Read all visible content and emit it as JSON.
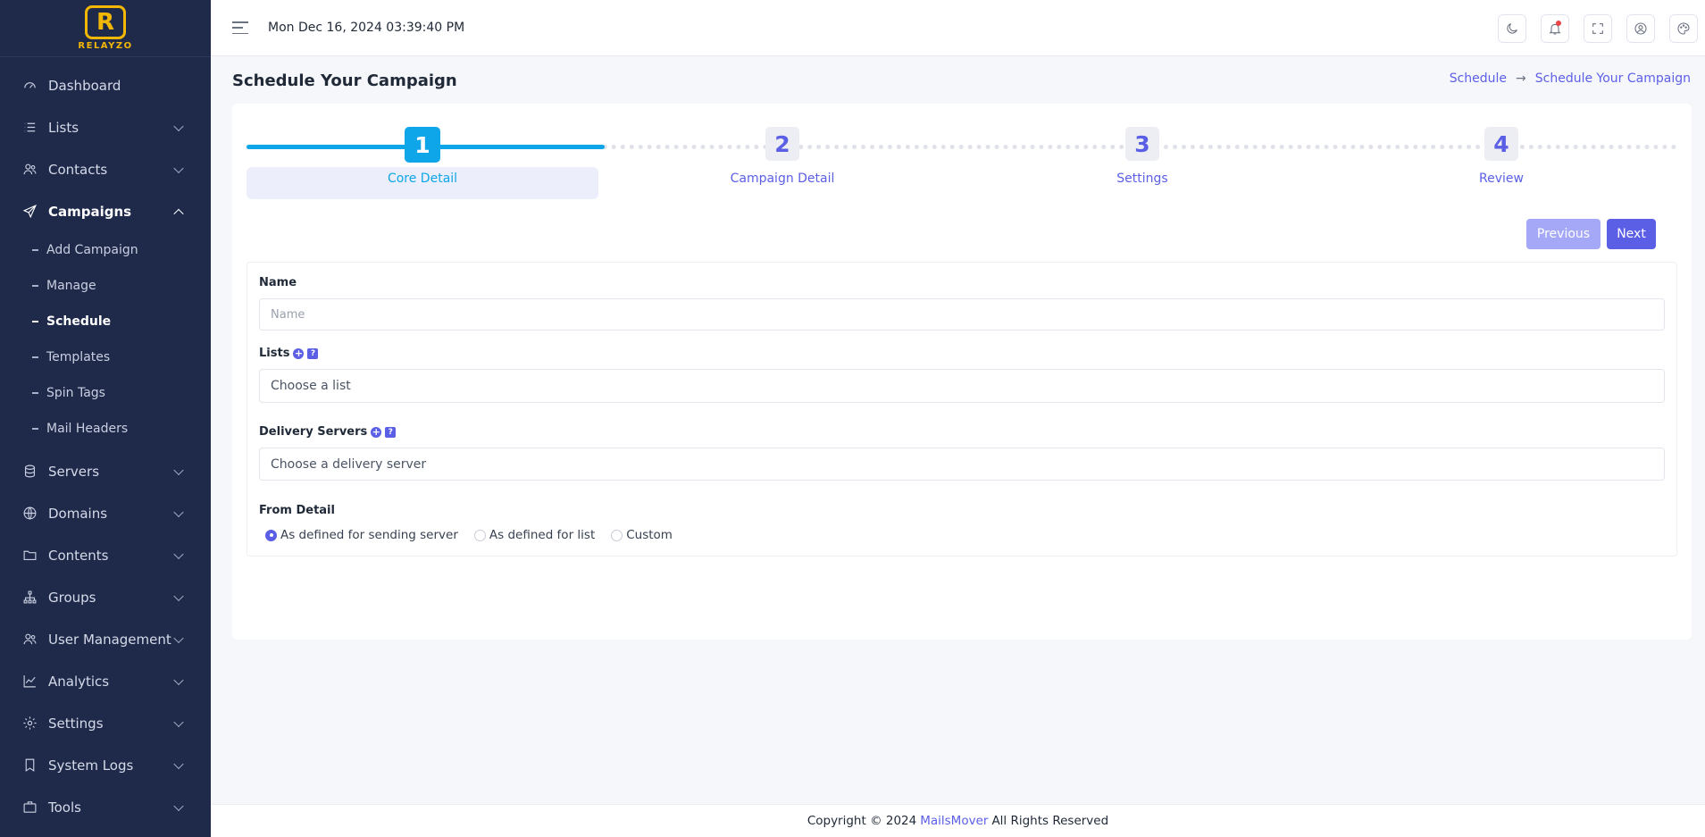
{
  "brand": {
    "mark": "R",
    "name": "RELAYZO"
  },
  "topbar": {
    "datetime": "Mon Dec 16, 2024 03:39:40 PM",
    "icons": [
      "moon-icon",
      "bell-icon",
      "fullscreen-icon",
      "user-icon",
      "palette-icon"
    ]
  },
  "sidebar": {
    "items": [
      {
        "label": "Dashboard",
        "icon": "gauge-icon",
        "expandable": false
      },
      {
        "label": "Lists",
        "icon": "list-icon",
        "expandable": true
      },
      {
        "label": "Contacts",
        "icon": "users-icon",
        "expandable": true
      },
      {
        "label": "Campaigns",
        "icon": "send-icon",
        "expandable": true,
        "open": true
      },
      {
        "label": "Servers",
        "icon": "database-icon",
        "expandable": true
      },
      {
        "label": "Domains",
        "icon": "globe-icon",
        "expandable": true
      },
      {
        "label": "Contents",
        "icon": "folder-icon",
        "expandable": true
      },
      {
        "label": "Groups",
        "icon": "sitemap-icon",
        "expandable": true
      },
      {
        "label": "User Management",
        "icon": "users-cog-icon",
        "expandable": true
      },
      {
        "label": "Analytics",
        "icon": "chart-line-icon",
        "expandable": true
      },
      {
        "label": "Settings",
        "icon": "gear-icon",
        "expandable": true
      },
      {
        "label": "System Logs",
        "icon": "bookmark-icon",
        "expandable": true
      },
      {
        "label": "Tools",
        "icon": "briefcase-icon",
        "expandable": true
      }
    ],
    "campaign_sub": [
      {
        "label": "Add Campaign"
      },
      {
        "label": "Manage"
      },
      {
        "label": "Schedule",
        "active": true
      },
      {
        "label": "Templates"
      },
      {
        "label": "Spin Tags"
      },
      {
        "label": "Mail Headers"
      }
    ]
  },
  "page": {
    "title": "Schedule Your Campaign",
    "breadcrumb": {
      "parent": "Schedule",
      "arrow": "→",
      "current": "Schedule Your Campaign"
    }
  },
  "stepper": {
    "steps": [
      {
        "num": "1",
        "label": "Core Detail",
        "active": true
      },
      {
        "num": "2",
        "label": "Campaign Detail"
      },
      {
        "num": "3",
        "label": "Settings"
      },
      {
        "num": "4",
        "label": "Review"
      }
    ],
    "progress": 0.25
  },
  "buttons": {
    "previous": "Previous",
    "next": "Next"
  },
  "form": {
    "name_label": "Name",
    "name_placeholder": "Name",
    "name_value": "",
    "lists_label": "Lists",
    "lists_placeholder": "Choose a list",
    "servers_label": "Delivery Servers",
    "servers_placeholder": "Choose a delivery server",
    "plus": "+",
    "help": "?",
    "from_label": "From Detail",
    "from_options": [
      {
        "label": "As defined for sending server",
        "selected": true
      },
      {
        "label": "As defined for list",
        "selected": false
      },
      {
        "label": "Custom",
        "selected": false
      }
    ]
  },
  "footer": {
    "prefix": "Copyright © 2024",
    "link": "MailsMover",
    "suffix": "All Rights Reserved"
  },
  "colors": {
    "sidebar": "#1f2a4b",
    "accent": "#5b5fe6",
    "active_step": "#0ea5e9",
    "brand": "#f2b705"
  }
}
